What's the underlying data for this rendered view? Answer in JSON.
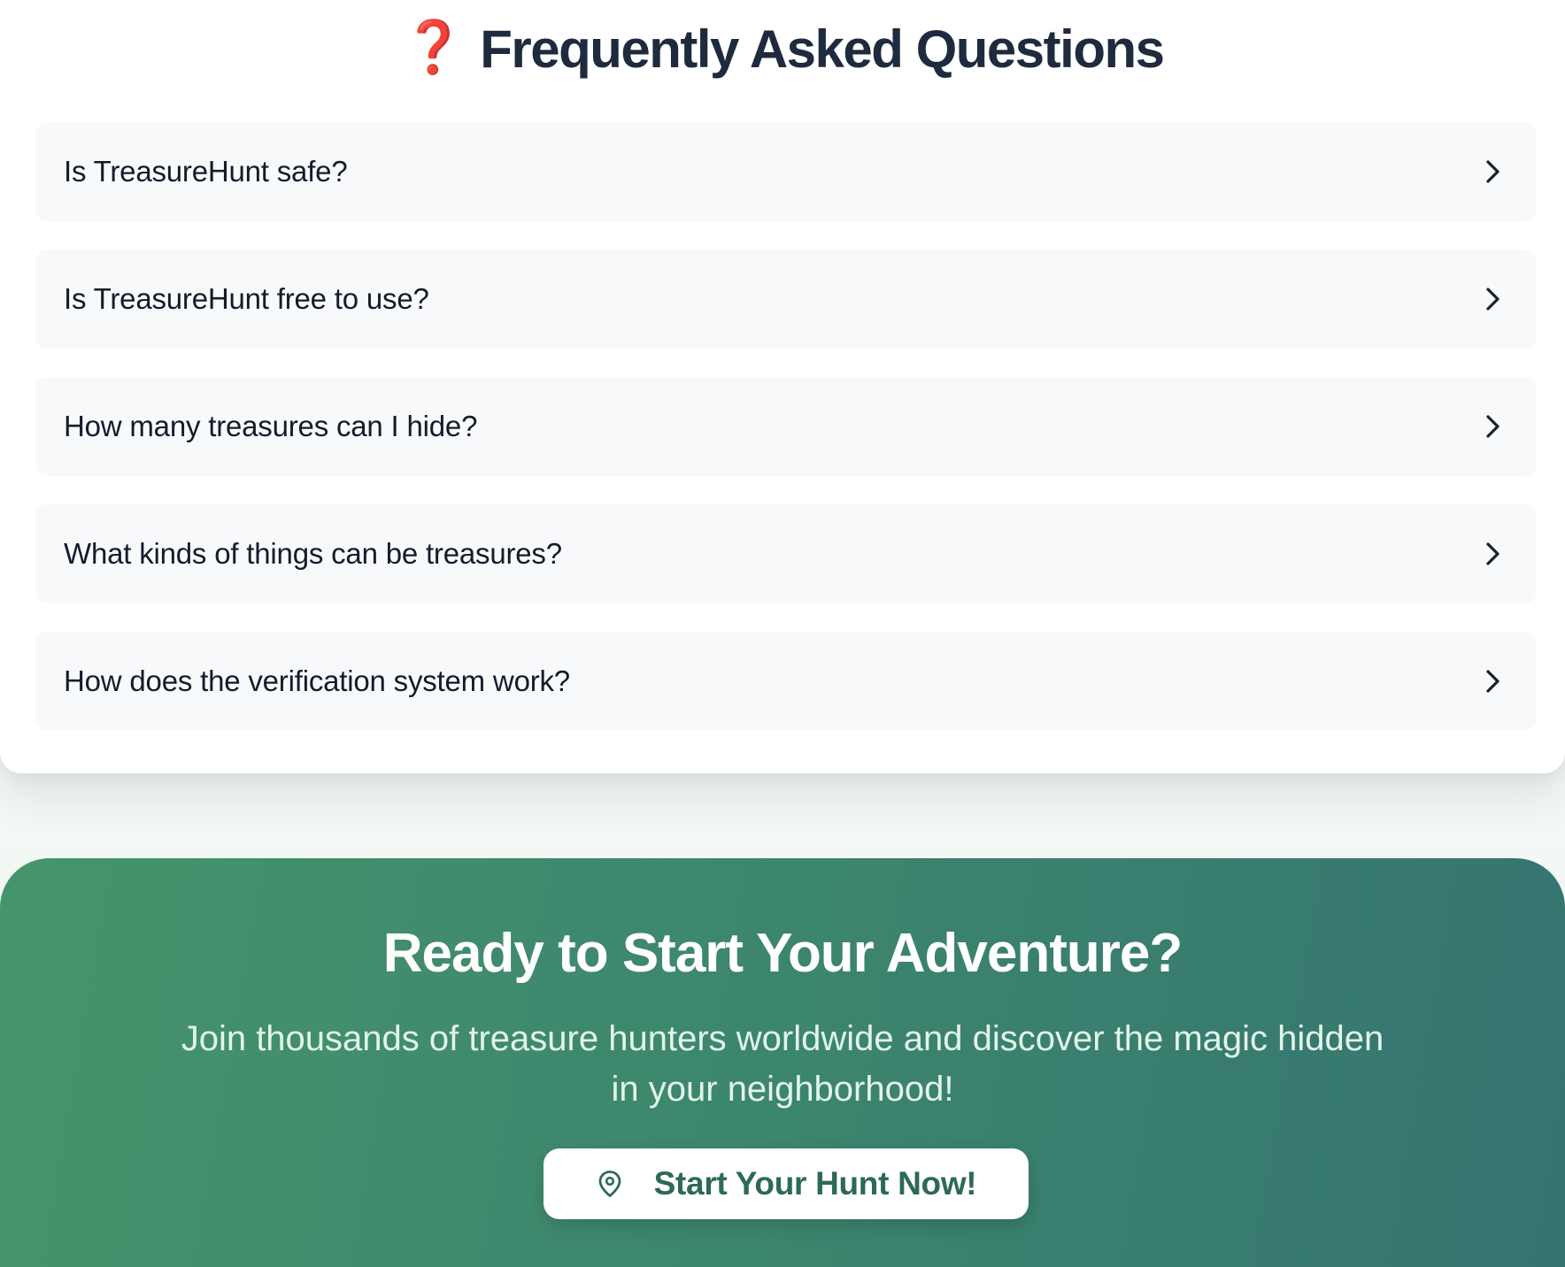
{
  "faq": {
    "icon": "question-mark-icon",
    "title": "Frequently Asked Questions",
    "items": [
      {
        "question": "Is TreasureHunt safe?",
        "icon": "chevron-right-icon"
      },
      {
        "question": "Is TreasureHunt free to use?",
        "icon": "chevron-right-icon"
      },
      {
        "question": "How many treasures can I hide?",
        "icon": "chevron-right-icon"
      },
      {
        "question": "What kinds of things can be treasures?",
        "icon": "chevron-right-icon"
      },
      {
        "question": "How does the verification system work?",
        "icon": "chevron-right-icon"
      }
    ]
  },
  "cta": {
    "title": "Ready to Start Your Adventure?",
    "subtitle": "Join thousands of treasure hunters worldwide and discover the magic hidden in your neighborhood!",
    "button_label": "Start Your Hunt Now!",
    "button_icon": "map-pin-icon"
  },
  "colors": {
    "title_text": "#1e2a3e",
    "question_mark": "#d42f22",
    "faq_item_bg": "#f8f9fb",
    "cta_gradient_start": "#46946c",
    "cta_gradient_end": "#357470",
    "cta_button_text": "#2d6a52"
  }
}
